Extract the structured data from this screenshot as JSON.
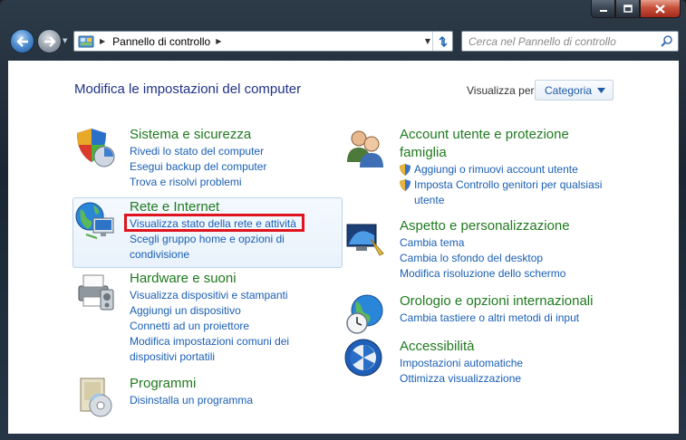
{
  "window": {
    "buttons": {
      "minimize": "minimize",
      "maximize": "maximize",
      "close": "close"
    }
  },
  "nav": {
    "address": "Pannello di controllo",
    "search_placeholder": "Cerca nel Pannello di controllo"
  },
  "header": {
    "title": "Modifica le impostazioni del computer",
    "view_by_label": "Visualizza per:",
    "view_by_value": "Categoria"
  },
  "categories": {
    "security": {
      "title": "Sistema e sicurezza",
      "links": [
        "Rivedi lo stato del computer",
        "Esegui backup del computer",
        "Trova e risolvi problemi"
      ]
    },
    "network": {
      "title": "Rete e Internet",
      "links": [
        "Visualizza stato della rete e attività",
        "Scegli gruppo home e opzioni di",
        "condivisione"
      ]
    },
    "hardware": {
      "title": "Hardware e suoni",
      "links": [
        "Visualizza dispositivi e stampanti",
        "Aggiungi un dispositivo",
        "Connetti ad un proiettore",
        "Modifica impostazioni comuni dei",
        "dispositivi portatili"
      ]
    },
    "programs": {
      "title": "Programmi",
      "links": [
        "Disinstalla un programma"
      ]
    },
    "accounts": {
      "title_line1": "Account utente e protezione",
      "title_line2": "famiglia",
      "links": [
        "Aggiungi o rimuovi account utente",
        "Imposta Controllo genitori per qualsiasi",
        "utente"
      ]
    },
    "appearance": {
      "title": "Aspetto e personalizzazione",
      "links": [
        "Cambia tema",
        "Cambia lo sfondo del desktop",
        "Modifica risoluzione dello schermo"
      ]
    },
    "clock": {
      "title": "Orologio e opzioni internazionali",
      "links": [
        "Cambia tastiere o altri metodi di input"
      ]
    },
    "access": {
      "title": "Accessibilità",
      "links": [
        "Impostazioni automatiche",
        "Ottimizza visualizzazione"
      ]
    }
  },
  "colors": {
    "link": "#1a5fb4",
    "category_title": "#1f7a1f",
    "page_title": "#1e3287",
    "annotation_red": "#e0141e"
  }
}
